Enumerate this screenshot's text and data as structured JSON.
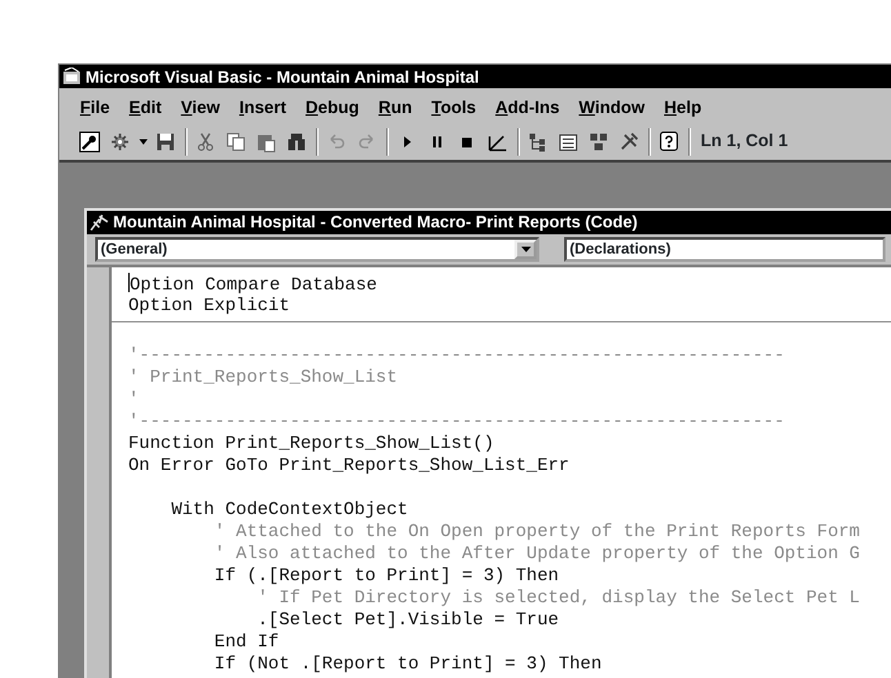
{
  "window": {
    "title": "Microsoft Visual Basic - Mountain Animal Hospital"
  },
  "menu": [
    "File",
    "Edit",
    "View",
    "Insert",
    "Debug",
    "Run",
    "Tools",
    "Add-Ins",
    "Window",
    "Help"
  ],
  "toolbar": {
    "position": "Ln 1, Col 1"
  },
  "code_window": {
    "title": "Mountain Animal Hospital - Converted Macro- Print Reports (Code)",
    "object_box": "(General)",
    "procedure_box": "(Declarations)",
    "sections": [
      {
        "lines": [
          {
            "kind": "code",
            "text": "Option Compare Database",
            "cursor": true
          },
          {
            "kind": "code",
            "text": "Option Explicit"
          }
        ]
      },
      {
        "lines": [
          {
            "kind": "blank"
          },
          {
            "kind": "comment",
            "text": "'------------------------------------------------------------"
          },
          {
            "kind": "comment",
            "text": "' Print_Reports_Show_List"
          },
          {
            "kind": "comment",
            "text": "'"
          },
          {
            "kind": "comment",
            "text": "'------------------------------------------------------------"
          },
          {
            "kind": "code",
            "text": "Function Print_Reports_Show_List()"
          },
          {
            "kind": "code",
            "text": "On Error GoTo Print_Reports_Show_List_Err"
          },
          {
            "kind": "blank"
          },
          {
            "kind": "code",
            "text": "    With CodeContextObject"
          },
          {
            "kind": "comment",
            "text": "        ' Attached to the On Open property of the Print Reports Form"
          },
          {
            "kind": "comment",
            "text": "        ' Also attached to the After Update property of the Option G"
          },
          {
            "kind": "code",
            "text": "        If (.[Report to Print] = 3) Then"
          },
          {
            "kind": "comment",
            "text": "            ' If Pet Directory is selected, display the Select Pet L"
          },
          {
            "kind": "code",
            "text": "            .[Select Pet].Visible = True"
          },
          {
            "kind": "code",
            "text": "        End If"
          },
          {
            "kind": "code",
            "text": "        If (Not .[Report to Print] = 3) Then"
          }
        ]
      }
    ]
  }
}
